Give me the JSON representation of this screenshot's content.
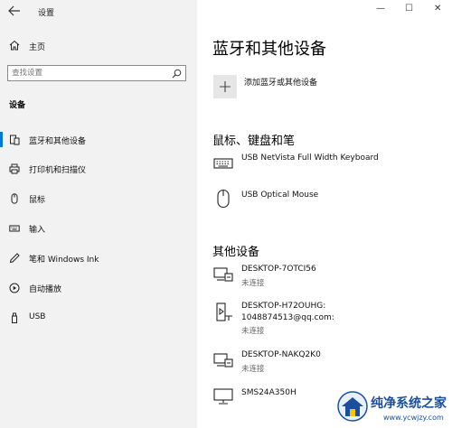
{
  "window": {
    "title": "设置",
    "controls": {
      "minimize": "—",
      "maximize": "☐",
      "close": "✕"
    }
  },
  "sidebar": {
    "home_label": "主页",
    "search": {
      "placeholder": "查找设置"
    },
    "section_title": "设备",
    "items": [
      {
        "label": "蓝牙和其他设备",
        "icon": "bluetooth-devices-icon",
        "active": true
      },
      {
        "label": "打印机和扫描仪",
        "icon": "printer-icon",
        "active": false
      },
      {
        "label": "鼠标",
        "icon": "mouse-icon",
        "active": false
      },
      {
        "label": "输入",
        "icon": "keyboard-icon",
        "active": false
      },
      {
        "label": "笔和 Windows Ink",
        "icon": "pen-icon",
        "active": false
      },
      {
        "label": "自动播放",
        "icon": "autoplay-icon",
        "active": false
      },
      {
        "label": "USB",
        "icon": "usb-icon",
        "active": false
      }
    ]
  },
  "main": {
    "title": "蓝牙和其他设备",
    "add_device_label": "添加蓝牙或其他设备",
    "mouse_keyboard_section": {
      "title": "鼠标、键盘和笔",
      "devices": [
        {
          "name": "USB NetVista Full Width Keyboard",
          "icon": "keyboard-icon"
        },
        {
          "name": "USB Optical Mouse",
          "icon": "mouse-icon"
        }
      ]
    },
    "other_section": {
      "title": "其他设备",
      "devices": [
        {
          "name": "DESKTOP-7OTCI56",
          "status": "未连接",
          "icon": "network-pc-icon"
        },
        {
          "name_line1": "DESKTOP-H72OUHG:",
          "name_line2": "1048874513@qq.com:",
          "status": "未连接",
          "icon": "media-device-icon"
        },
        {
          "name": "DESKTOP-NAKQ2K0",
          "status": "未连接",
          "icon": "network-pc-icon"
        },
        {
          "name": "SMS24A350H",
          "icon": "monitor-icon"
        }
      ]
    }
  },
  "watermark": {
    "text": "纯净系统之家",
    "url": "www.ycwjzy.com"
  },
  "colors": {
    "accent": "#0078d7",
    "sidebar_bg": "#f2f2f2",
    "content_bg": "#ffffff"
  }
}
